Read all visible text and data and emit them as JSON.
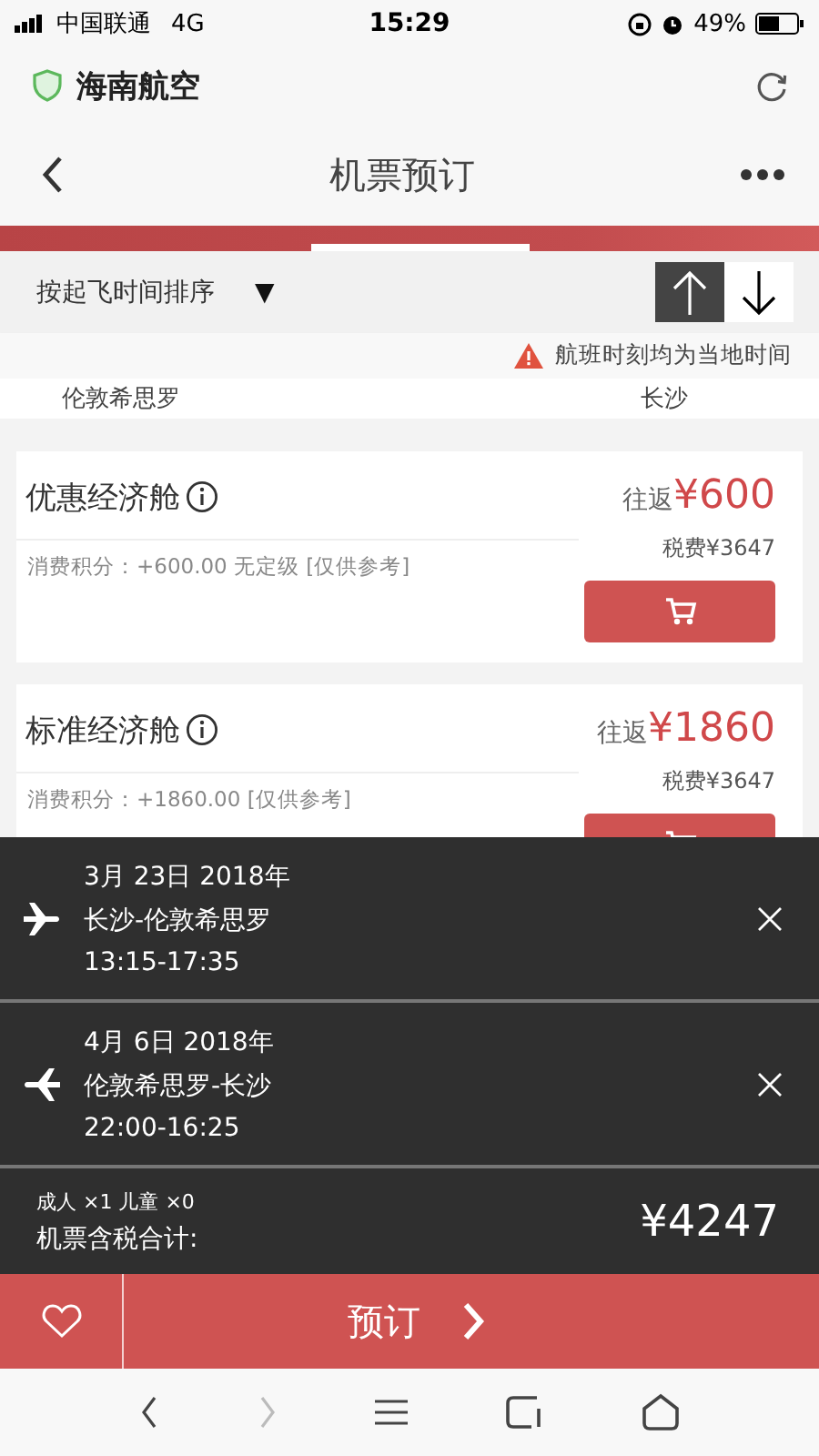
{
  "status_bar": {
    "carrier": "中国联通",
    "network": "4G",
    "time": "15:29",
    "battery": "49%"
  },
  "browser": {
    "title": "海南航空"
  },
  "header": {
    "title": "机票预订"
  },
  "sort": {
    "label": "按起飞时间排序",
    "caret": "▼",
    "directions": [
      {
        "kind": "up",
        "selected": true
      },
      {
        "kind": "down",
        "selected": false
      }
    ]
  },
  "notice": "航班时刻均为当地时间",
  "route": {
    "from": "伦敦希思罗",
    "to": "长沙"
  },
  "fares": [
    {
      "name": "优惠经济舱",
      "trip": "往返",
      "price": "¥600",
      "tax": "税费¥3647",
      "points": "消费积分：+600.00 无定级 [仅供参考]"
    },
    {
      "name": "标准经济舱",
      "trip": "往返",
      "price": "¥1860",
      "tax": "税费¥3647",
      "points": "消费积分：+1860.00 [仅供参考]"
    }
  ],
  "selection": {
    "flights": [
      {
        "kind": "outbound",
        "date": "3月 23日 2018年",
        "route": "长沙-伦敦希思罗",
        "time": "13:15-17:35"
      },
      {
        "kind": "return",
        "date": "4月 6日 2018年",
        "route": "伦敦希思罗-长沙",
        "time": "22:00-16:25"
      }
    ],
    "passengers": "成人 ×1 儿童 ×0",
    "total_label": "机票含税合计:",
    "total": "¥4247"
  },
  "action": {
    "book": "预订"
  }
}
